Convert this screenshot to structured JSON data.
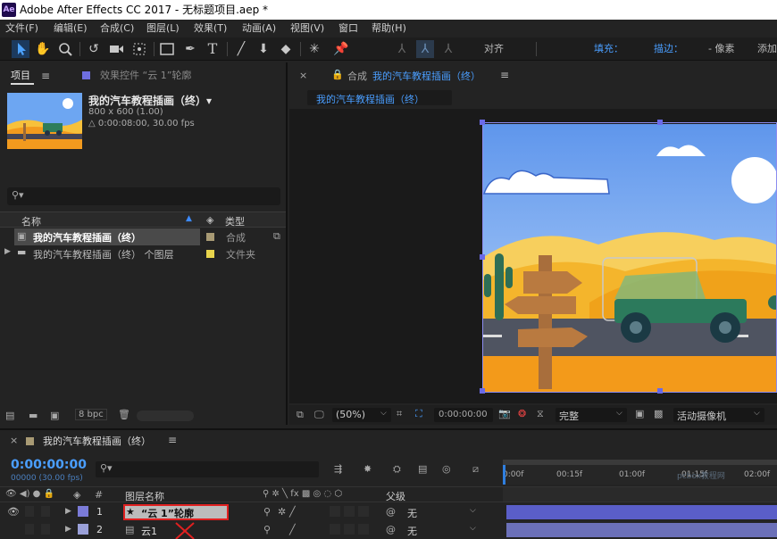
{
  "window": {
    "app_icon": "Ae",
    "title": "Adobe After Effects CC 2017 - 无标题项目.aep *"
  },
  "menu": [
    "文件(F)",
    "编辑(E)",
    "合成(C)",
    "图层(L)",
    "效果(T)",
    "动画(A)",
    "视图(V)",
    "窗口",
    "帮助(H)"
  ],
  "toolbar": {
    "align_label": "对齐",
    "fill_label": "填充：",
    "stroke_label": "描边：",
    "stroke_value": "?",
    "pixel_label": "- 像素",
    "add_label": "添加"
  },
  "project": {
    "tab_label": "项目",
    "effects_tab_label": "效果控件 “云 1”轮廓",
    "comp_name": "我的汽车教程插画（终）▾",
    "comp_size": "800 x 600 (1.00)",
    "comp_duration": "△ 0:00:08:00, 30.00 fps",
    "search_placeholder": "",
    "col_name": "名称",
    "col_type": "类型",
    "items": [
      {
        "name": "我的汽车教程插画（终）",
        "type": "合成",
        "color": "#a89a74"
      },
      {
        "name": "我的汽车教程插画（终） 个图层",
        "type": "文件夹",
        "color": "#e8d44c"
      }
    ],
    "bpc": "8 bpc"
  },
  "comp": {
    "tab_prefix": "合成",
    "tab_name": "我的汽车教程插画（终）",
    "breadcrumb": "我的汽车教程插画（终）",
    "zoom": "(50%)",
    "timecode": "0:00:00:00",
    "quality": "完整",
    "camera": "活动摄像机"
  },
  "timeline": {
    "tab_name": "我的汽车教程插画（终）",
    "timecode": "0:00:00:00",
    "frames": "00000 (30.00 fps)",
    "col_num": "#",
    "col_layer_name": "图层名称",
    "col_parent": "父级",
    "ruler": [
      "0:00f",
      "00:15f",
      "01:00f",
      "01:15f",
      "02:00f"
    ],
    "layers": [
      {
        "num": "1",
        "name": "“云 1”轮廓",
        "parent": "无",
        "color": "#7b7bd8"
      },
      {
        "num": "2",
        "name": "云1",
        "parent": "无",
        "color": "#9aa0d8"
      }
    ],
    "watermark": "pcbox教程网"
  }
}
